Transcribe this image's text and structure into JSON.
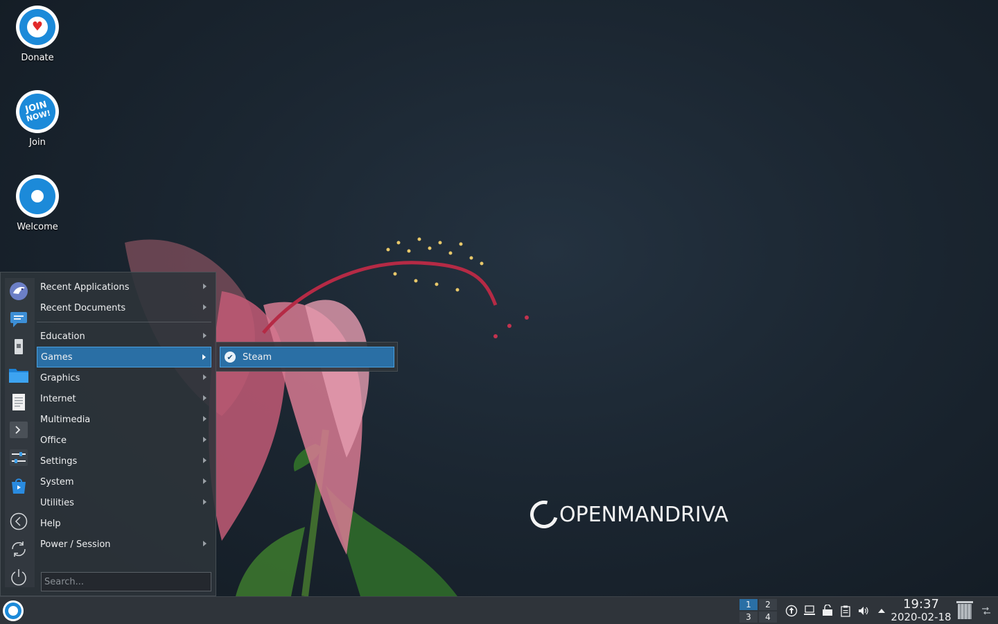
{
  "desktop": {
    "icons": [
      {
        "label": "Donate",
        "icon": "donate-heart-icon"
      },
      {
        "label": "Join",
        "icon": "join-now-icon",
        "badge_line1": "JOIN",
        "badge_line2": "NOW!"
      },
      {
        "label": "Welcome",
        "icon": "openmandriva-welcome-icon"
      }
    ],
    "wallpaper_brand": "OPENMANDRIVA"
  },
  "launcher": {
    "favorites": [
      {
        "icon": "eagle-browser-icon"
      },
      {
        "icon": "chat-icon"
      },
      {
        "icon": "usb-drive-icon"
      },
      {
        "icon": "folder-icon"
      },
      {
        "icon": "text-document-icon"
      },
      {
        "icon": "terminal-icon"
      },
      {
        "icon": "settings-sliders-icon"
      },
      {
        "icon": "software-center-icon"
      }
    ],
    "actions": [
      {
        "icon": "logout-arrow-icon"
      },
      {
        "icon": "restart-icon"
      },
      {
        "icon": "power-icon"
      }
    ],
    "items": [
      {
        "label": "Recent Applications",
        "submenu": true
      },
      {
        "label": "Recent Documents",
        "submenu": true
      },
      {
        "label": "Education",
        "submenu": true
      },
      {
        "label": "Games",
        "submenu": true,
        "active": true
      },
      {
        "label": "Graphics",
        "submenu": true
      },
      {
        "label": "Internet",
        "submenu": true
      },
      {
        "label": "Multimedia",
        "submenu": true
      },
      {
        "label": "Office",
        "submenu": true
      },
      {
        "label": "Settings",
        "submenu": true
      },
      {
        "label": "System",
        "submenu": true
      },
      {
        "label": "Utilities",
        "submenu": true
      },
      {
        "label": "Help",
        "submenu": false
      },
      {
        "label": "Power / Session",
        "submenu": true
      }
    ],
    "search": {
      "placeholder": "Search...",
      "value": ""
    },
    "submenu": {
      "items": [
        {
          "label": "Steam",
          "icon": "steam-icon"
        }
      ]
    }
  },
  "taskbar": {
    "pager": [
      "1",
      "2",
      "3",
      "4"
    ],
    "current_desktop": "1",
    "tray_icons": [
      "updater-icon",
      "network-icon",
      "vault-icon",
      "clipboard-icon",
      "volume-icon",
      "expand-tray-icon"
    ],
    "clock": {
      "time": "19:37",
      "date": "2020-02-18"
    },
    "colors": {
      "panel": "#2f343a",
      "accent": "#2a6fa5"
    }
  }
}
